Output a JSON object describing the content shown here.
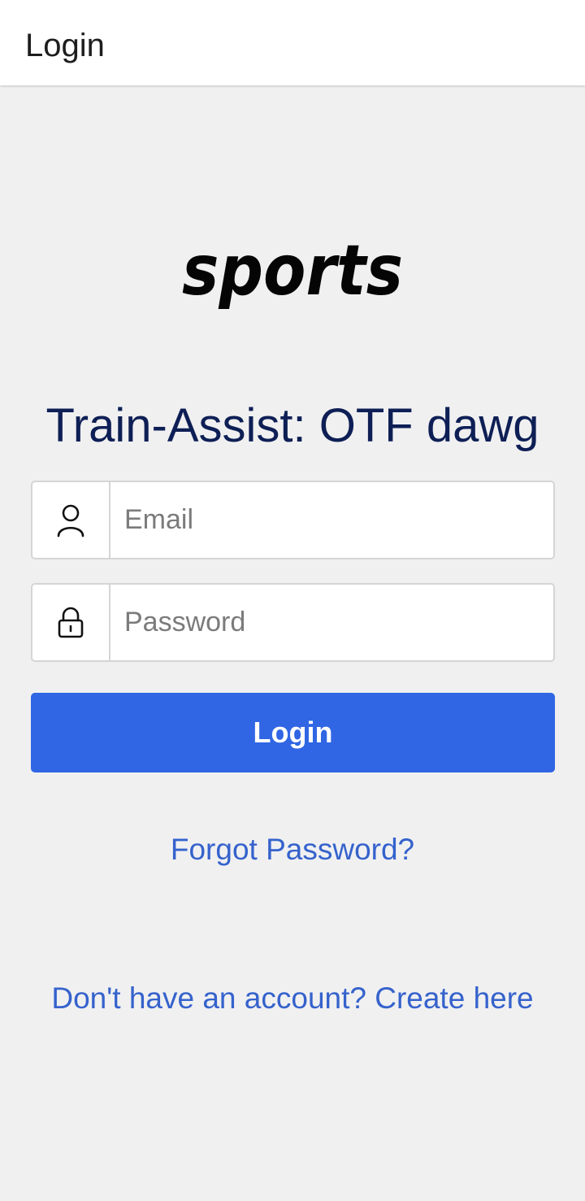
{
  "app_bar": {
    "title": "Login"
  },
  "logo": {
    "text": "sports"
  },
  "app_name": "Train-Assist: OTF dawg",
  "form": {
    "email": {
      "placeholder": "Email",
      "value": "",
      "icon": "user-icon"
    },
    "password": {
      "placeholder": "Password",
      "value": "",
      "icon": "lock-icon"
    },
    "login_label": "Login"
  },
  "links": {
    "forgot_password": "Forgot Password?",
    "create_account": "Don't have an account? Create here"
  },
  "colors": {
    "background": "#f0f0f1",
    "primary_button": "#3066e4",
    "link": "#3562cc",
    "app_name": "#0e1f55"
  }
}
